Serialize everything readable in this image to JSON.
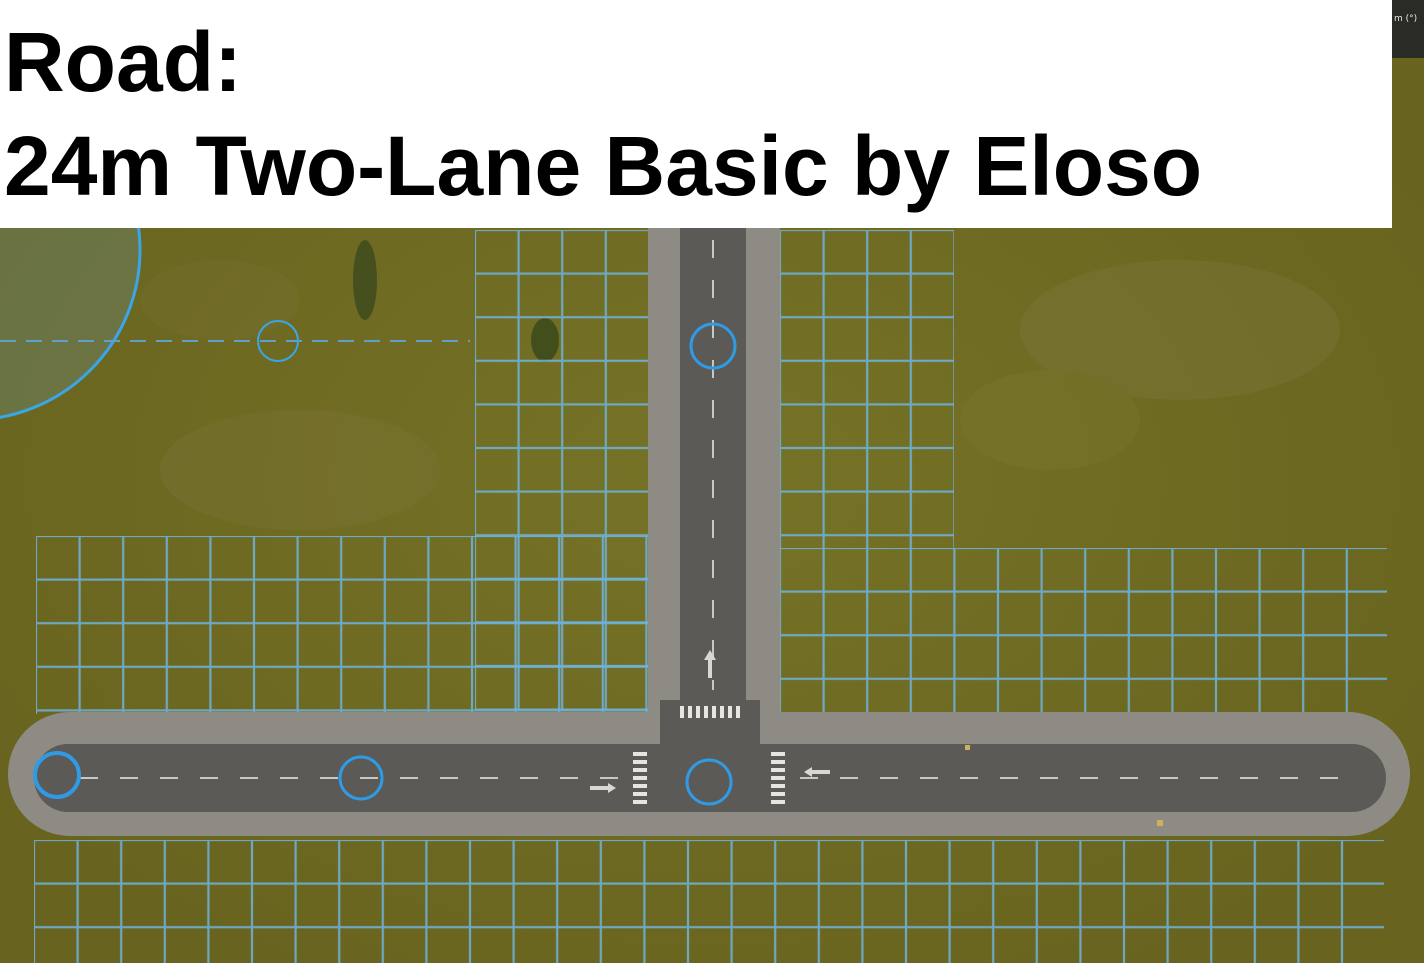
{
  "title": {
    "line1": "Road:",
    "line2": "24m Two-Lane Basic by Eloso"
  },
  "hud": {
    "label": "m (°)"
  },
  "scene": {
    "ground_color": "#6f6b22",
    "road_color": "#5b5a57",
    "sidewalk_color": "#8d8b84",
    "zone_grid_color": "#6fb3e0",
    "node_marker_color": "#2f9be6"
  }
}
